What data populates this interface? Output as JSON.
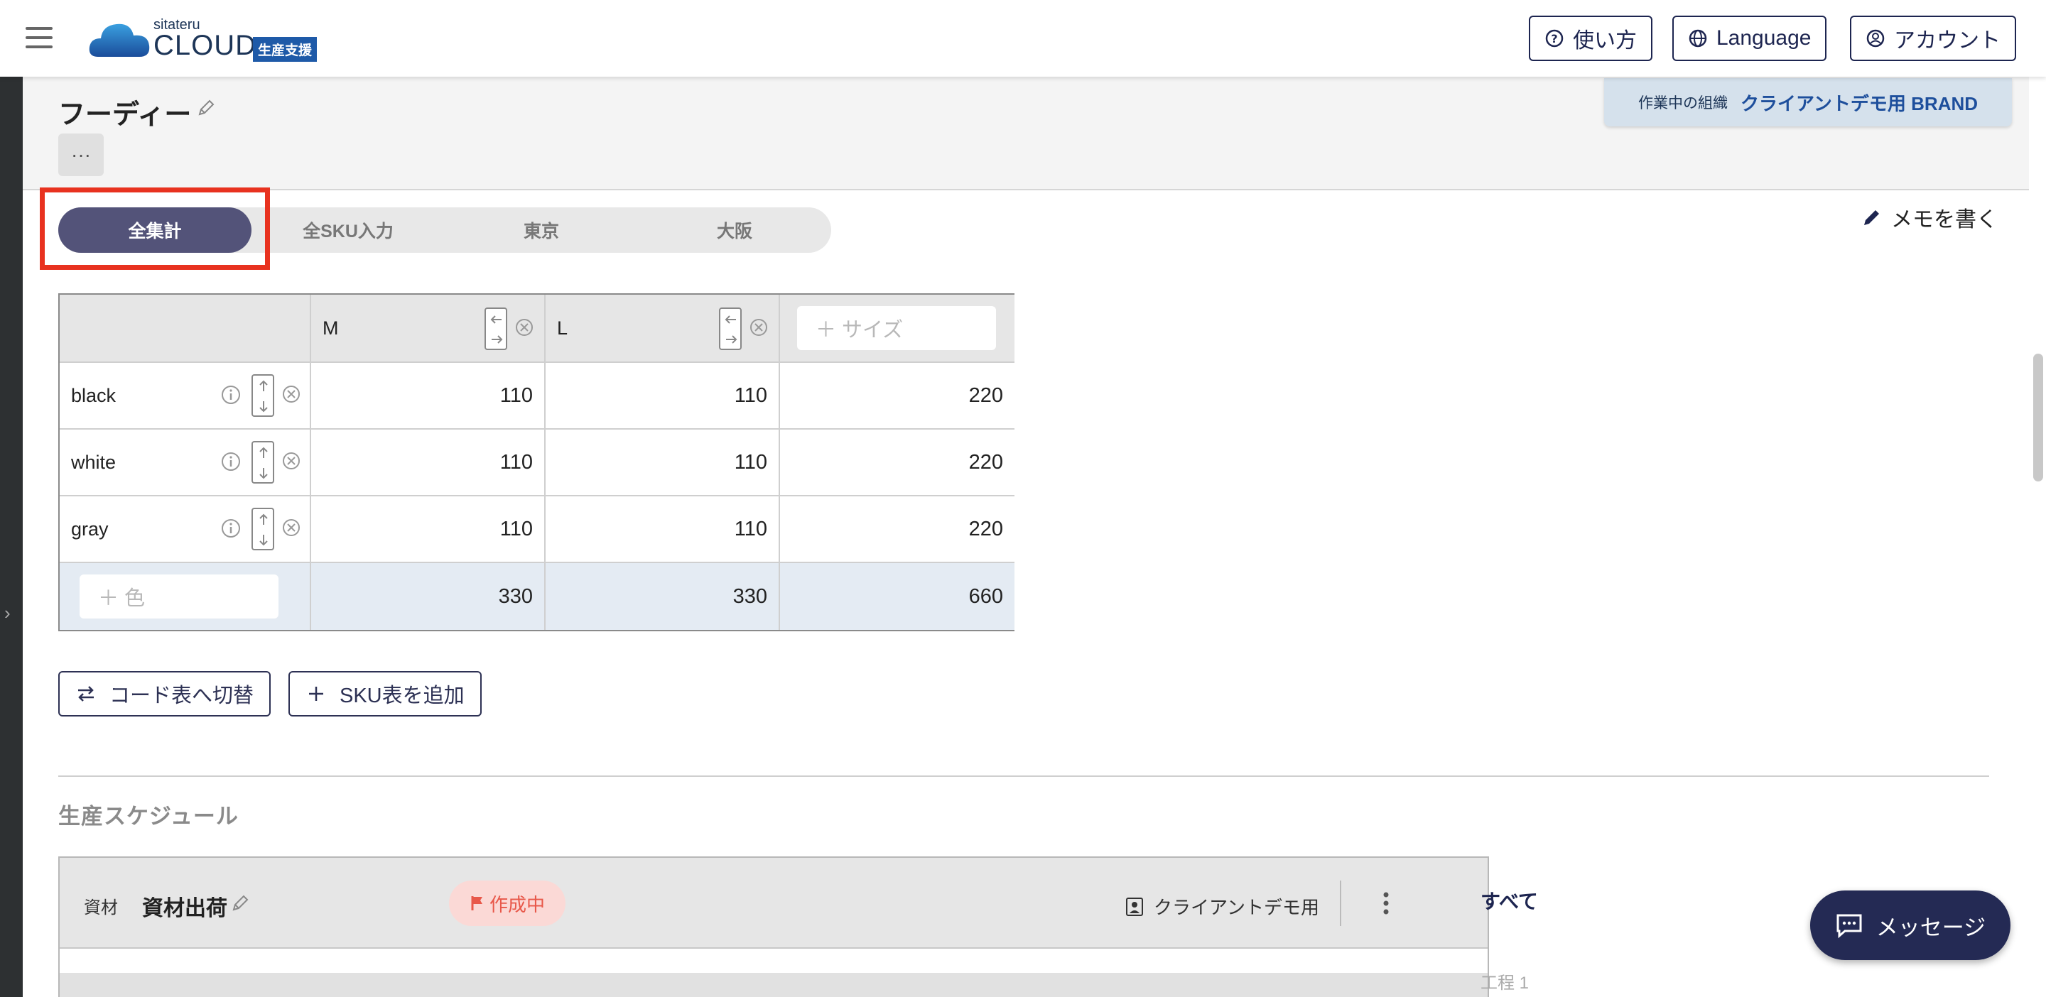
{
  "header": {
    "logo_small": "sitateru",
    "logo_main": "CLOUD",
    "logo_badge": "生産支援",
    "help_label": "使い方",
    "language_label": "Language",
    "account_label": "アカウント"
  },
  "org": {
    "label": "作業中の組織",
    "name": "クライアントデモ用 BRAND"
  },
  "product": {
    "title": "フーディー",
    "more_label": "···",
    "memo_label": "メモを書く"
  },
  "tabs": [
    {
      "label": "全集計",
      "active": true
    },
    {
      "label": "全SKU入力",
      "active": false
    },
    {
      "label": "東京",
      "active": false
    },
    {
      "label": "大阪",
      "active": false
    }
  ],
  "sku_table": {
    "sizes": [
      "M",
      "L"
    ],
    "size_placeholder": "＋ サイズ",
    "color_placeholder": "＋ 色",
    "rows": [
      {
        "color": "black",
        "values": [
          "110",
          "110"
        ],
        "total": "220"
      },
      {
        "color": "white",
        "values": [
          "110",
          "110"
        ],
        "total": "220"
      },
      {
        "color": "gray",
        "values": [
          "110",
          "110"
        ],
        "total": "220"
      }
    ],
    "totals": [
      "330",
      "330",
      "660"
    ]
  },
  "actions": {
    "switch_code": "コード表へ切替",
    "add_sku": "SKU表を追加"
  },
  "schedule": {
    "section_title": "生産スケジュール",
    "type": "資材",
    "name": "資材出荷",
    "status": "作成中",
    "assignee": "クライアントデモ用",
    "filter_all": "すべて",
    "step_label": "工程 1"
  },
  "message_button": "メッセージ",
  "colors": {
    "accent": "#535379",
    "header_button": "#1d2550",
    "highlight": "#e8321f",
    "status_bg": "#fbd9d6",
    "status_fg": "#e8584a",
    "total_row": "#e4ebf3"
  }
}
